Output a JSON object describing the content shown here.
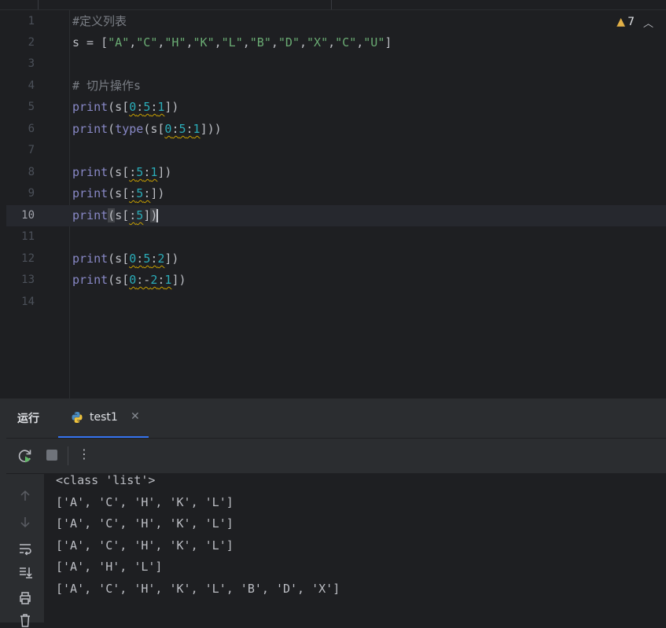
{
  "editor": {
    "lines": [
      {
        "n": "1"
      },
      {
        "n": "2"
      },
      {
        "n": "3"
      },
      {
        "n": "4"
      },
      {
        "n": "5"
      },
      {
        "n": "6"
      },
      {
        "n": "7"
      },
      {
        "n": "8"
      },
      {
        "n": "9"
      },
      {
        "n": "10"
      },
      {
        "n": "11"
      },
      {
        "n": "12"
      },
      {
        "n": "13"
      },
      {
        "n": "14"
      }
    ],
    "comment1": "#定义列表",
    "list_strings": [
      "\"A\"",
      "\"C\"",
      "\"H\"",
      "\"K\"",
      "\"L\"",
      "\"B\"",
      "\"D\"",
      "\"X\"",
      "\"C\"",
      "\"U\""
    ],
    "comment2": "# 切片操作s",
    "warnings_count": "7"
  },
  "run_panel": {
    "label": "运行",
    "tab_label": "test1",
    "output": [
      "<class 'list'>",
      "['A', 'C', 'H', 'K', 'L']",
      "['A', 'C', 'H', 'K', 'L']",
      "['A', 'C', 'H', 'K', 'L']",
      "['A', 'H', 'L']",
      "['A', 'C', 'H', 'K', 'L', 'B', 'D', 'X']"
    ]
  },
  "colors": {
    "editor_bg": "#1e1f22",
    "panel_bg": "#2b2d30",
    "accent": "#3574f0",
    "warning": "#e2b047"
  }
}
